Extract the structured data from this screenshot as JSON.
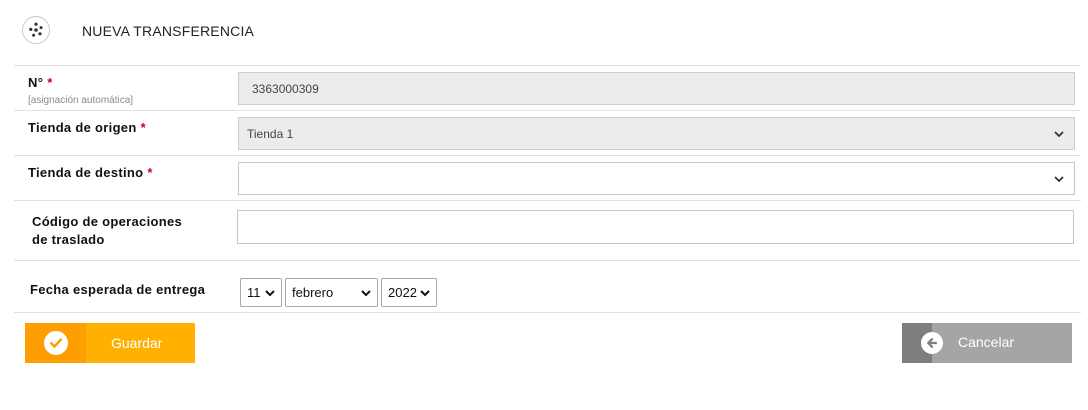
{
  "header": {
    "title": "NUEVA TRANSFERENCIA",
    "logo_icon": "pinwheel-logo-icon"
  },
  "form": {
    "number": {
      "label": "N°",
      "required_mark": "*",
      "hint": "[asignación automática]",
      "value": "3363000309"
    },
    "origin_store": {
      "label": "Tienda de origen",
      "required_mark": "*",
      "value": "Tienda 1"
    },
    "destination_store": {
      "label": "Tienda de destino",
      "required_mark": "*",
      "value": ""
    },
    "transfer_code": {
      "label_line1": "Código de operaciones",
      "label_line2": "de traslado",
      "value": ""
    },
    "expected_date": {
      "label": "Fecha esperada de entrega",
      "day": "11",
      "month": "febrero",
      "year": "2022"
    }
  },
  "actions": {
    "save_label": "Guardar",
    "cancel_label": "Cancelar"
  },
  "colors": {
    "save_bg": "#ffb000",
    "save_strip": "#ff9e00",
    "cancel_bg": "#a5a5a5",
    "cancel_strip": "#7e7e7e",
    "required": "#d0021b"
  }
}
